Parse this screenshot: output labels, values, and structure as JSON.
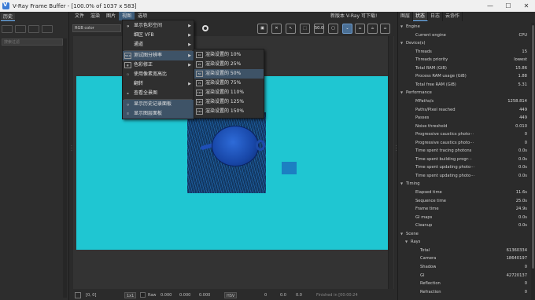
{
  "window": {
    "title": "V-Ray Frame Buffer - [100.0% of 1037 x 583]",
    "minimize_glyph": "—",
    "maximize_glyph": "☐",
    "close_glyph": "✕"
  },
  "left_panel": {
    "tab_label": "历史",
    "search_placeholder": "搜索过滤"
  },
  "menubar": {
    "items": [
      "文件",
      "渲染",
      "图片",
      "视图",
      "选项"
    ],
    "update_text": "新版本 V-Ray 可下载!"
  },
  "toolbar": {
    "channel_select": "RGB color",
    "badge_50": "50.0"
  },
  "view_menu": {
    "items": [
      {
        "label": "显示色彩空间",
        "has_submenu": true
      },
      {
        "label": "细区 VFB",
        "has_submenu": true
      },
      {
        "label": "通道",
        "has_submenu": true
      },
      {
        "label": "测试图分辨率",
        "has_submenu": true,
        "icon_text": "50.0"
      },
      {
        "label": "色彩修正",
        "has_submenu": true
      },
      {
        "label": "使用像素宽高比"
      },
      {
        "label": "翻转",
        "has_submenu": true
      },
      {
        "label": "查看全景图"
      },
      {
        "label": "显示历史记录面板"
      },
      {
        "label": "显示图层面板"
      }
    ]
  },
  "resolution_submenu": {
    "items": [
      {
        "label": "渲染设置的 10%",
        "icon_text": "10"
      },
      {
        "label": "渲染设置的 25%",
        "icon_text": "25"
      },
      {
        "label": "渲染设置的 50%",
        "icon_text": "50"
      },
      {
        "label": "渲染设置的 75%",
        "icon_text": "75"
      },
      {
        "label": "渲染设置的 110%",
        "icon_text": "110"
      },
      {
        "label": "渲染设置的 125%",
        "icon_text": "125"
      },
      {
        "label": "渲染设置的 150%",
        "icon_text": "150"
      }
    ]
  },
  "statusbar": {
    "coords": "[0, 0]",
    "zoom_select": "1x1",
    "mode_label": "Raw",
    "r": "0.000",
    "g": "0.000",
    "b": "0.000",
    "color_mode": "HSV",
    "h": "0",
    "s": "0.0",
    "v": "0.0",
    "finished": "Finished in [00:00:24"
  },
  "right_panel": {
    "tabs": [
      "图层",
      "状态",
      "日志",
      "云协作"
    ],
    "active_tab": "状态",
    "rows": [
      {
        "type": "section",
        "label": "Engine",
        "indent": 0
      },
      {
        "label": "Current engine",
        "value": "CPU",
        "indent": 2
      },
      {
        "type": "section",
        "label": "Device(s)",
        "indent": 0
      },
      {
        "label": "Threads",
        "value": "15",
        "indent": 2
      },
      {
        "label": "Threads priority",
        "value": "lowest",
        "indent": 2
      },
      {
        "label": "Total RAM (GiB)",
        "value": "15.86",
        "indent": 2
      },
      {
        "label": "Process RAM usage (GiB)",
        "value": "1.88",
        "indent": 2
      },
      {
        "label": "Total free RAM (GiB)",
        "value": "5.31",
        "indent": 2
      },
      {
        "type": "section",
        "label": "Performance",
        "indent": 0
      },
      {
        "label": "MPaths/s",
        "value": "1258.814",
        "indent": 2
      },
      {
        "label": "Paths/Pixel reached",
        "value": "449",
        "indent": 2
      },
      {
        "label": "Passes",
        "value": "449",
        "indent": 2
      },
      {
        "label": "Noise threshold",
        "value": "0.010",
        "indent": 2
      },
      {
        "label": "Progressive caustics photo···",
        "value": "0",
        "indent": 2
      },
      {
        "label": "Progressive caustics photo···",
        "value": "0",
        "indent": 2
      },
      {
        "label": "Time spent tracing photons",
        "value": "0.0s",
        "indent": 2
      },
      {
        "label": "Time spent building progr···",
        "value": "0.0s",
        "indent": 2
      },
      {
        "label": "Time spent updating photo···",
        "value": "0.0s",
        "indent": 2
      },
      {
        "label": "Time spent updating photo···",
        "value": "0.0s",
        "indent": 2
      },
      {
        "type": "section",
        "label": "Timing",
        "indent": 0
      },
      {
        "label": "Elapsed time",
        "value": "11.6s",
        "indent": 2
      },
      {
        "label": "Sequence time",
        "value": "25.0s",
        "indent": 2
      },
      {
        "label": "Frame time",
        "value": "24.9s",
        "indent": 2
      },
      {
        "label": "GI maps",
        "value": "0.0s",
        "indent": 2
      },
      {
        "label": "Cleanup",
        "value": "0.0s",
        "indent": 2
      },
      {
        "type": "section",
        "label": "Scene",
        "indent": 0
      },
      {
        "type": "section",
        "label": "Rays",
        "indent": 1
      },
      {
        "label": "Total",
        "value": "61360334",
        "indent": 3
      },
      {
        "label": "Camera",
        "value": "18640197",
        "indent": 3
      },
      {
        "label": "Shadow",
        "value": "0",
        "indent": 3
      },
      {
        "label": "GI",
        "value": "42720137",
        "indent": 3
      },
      {
        "label": "Reflection",
        "value": "0",
        "indent": 3
      },
      {
        "label": "Refraction",
        "value": "0",
        "indent": 3
      }
    ]
  },
  "colors": {
    "background": "#1fc6d2",
    "accent": "#6cb6ff",
    "menu_highlight": "#3e5367"
  }
}
